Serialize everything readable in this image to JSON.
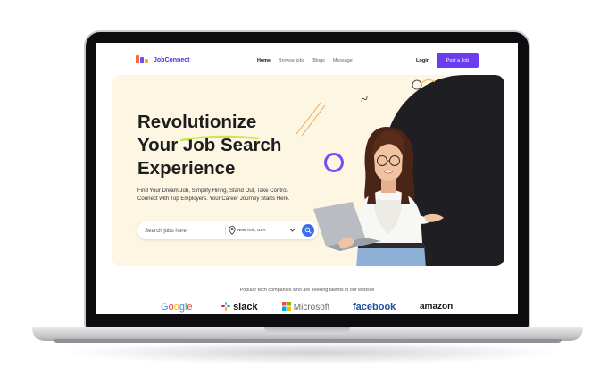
{
  "brand": {
    "name": "JobConnect"
  },
  "nav": {
    "items": [
      "Home",
      "Browse jobs",
      "Blogs",
      "Message"
    ],
    "login": "Login",
    "post_job": "Post a Job"
  },
  "hero": {
    "headline": [
      "Revolutionize",
      "Your Job Search",
      "Experience"
    ],
    "subtext": "Find Your Dream Job, Simplify Hiring, Stand Out, Take Control. Connect with Top Employers. Your Career Journey Starts Here.",
    "search_placeholder": "Search jobs here",
    "location": "New York, USA"
  },
  "companies": {
    "caption": "Popular tech companies who are seeking talents in our website",
    "logos": [
      "Google",
      "slack",
      "Microsoft",
      "facebook",
      "amazon"
    ]
  },
  "colors": {
    "accent": "#6a3df0",
    "search_button": "#3d6cf0",
    "hero_bg": "#fdf6e3",
    "dark_panel": "#1f1e23"
  },
  "icons": [
    "logo-icon",
    "location-pin-icon",
    "chevron-down-icon",
    "search-icon"
  ]
}
